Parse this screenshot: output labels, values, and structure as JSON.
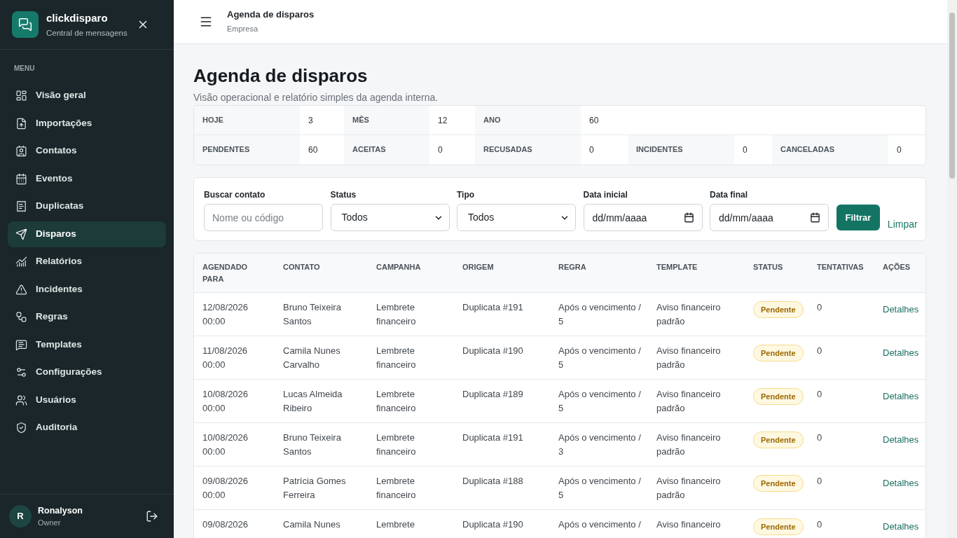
{
  "sidebar": {
    "brand": {
      "name": "clickdisparo",
      "tagline": "Central de mensagens"
    },
    "section_label": "MENU",
    "items": [
      {
        "label": "Visão geral",
        "selected": false
      },
      {
        "label": "Importações",
        "selected": false
      },
      {
        "label": "Contatos",
        "selected": false
      },
      {
        "label": "Eventos",
        "selected": false
      },
      {
        "label": "Duplicatas",
        "selected": false
      },
      {
        "label": "Disparos",
        "selected": true
      },
      {
        "label": "Relatórios",
        "selected": false
      },
      {
        "label": "Incidentes",
        "selected": false
      },
      {
        "label": "Regras",
        "selected": false
      },
      {
        "label": "Templates",
        "selected": false
      },
      {
        "label": "Configurações",
        "selected": false
      },
      {
        "label": "Usuários",
        "selected": false
      },
      {
        "label": "Auditoria",
        "selected": false
      }
    ],
    "user": {
      "initial": "R",
      "name": "Ronalyson",
      "role": "Owner"
    }
  },
  "topbar": {
    "title": "Agenda de disparos",
    "subtitle": "Empresa"
  },
  "page": {
    "title": "Agenda de disparos",
    "description": "Visão operacional e relatório simples da agenda interna."
  },
  "summary": {
    "rows": [
      [
        {
          "label": "HOJE",
          "value": "3"
        },
        {
          "label": "MÊS",
          "value": "12"
        },
        {
          "label": "ANO",
          "value": "60"
        }
      ],
      [
        {
          "label": "PENDENTES",
          "value": "60"
        },
        {
          "label": "ACEITAS",
          "value": "0"
        },
        {
          "label": "RECUSADAS",
          "value": "0"
        },
        {
          "label": "INCIDENTES",
          "value": "0"
        },
        {
          "label": "CANCELADAS",
          "value": "0"
        }
      ]
    ]
  },
  "filters": {
    "fields": [
      {
        "kind": "text",
        "label": "Buscar contato",
        "placeholder": "Nome ou código"
      },
      {
        "kind": "select",
        "label": "Status",
        "value": "Todos"
      },
      {
        "kind": "select",
        "label": "Tipo",
        "value": "Todos"
      },
      {
        "kind": "date",
        "label": "Data inicial",
        "placeholder": "dd/mm/aaaa"
      },
      {
        "kind": "date",
        "label": "Data final",
        "placeholder": "dd/mm/aaaa"
      }
    ],
    "submit": "Filtrar",
    "clear": "Limpar"
  },
  "table": {
    "columns": [
      "AGENDADO PARA",
      "CONTATO",
      "CAMPANHA",
      "ORIGEM",
      "REGRA",
      "TEMPLATE",
      "STATUS",
      "TENTATIVAS",
      "AÇÕES"
    ],
    "rows": [
      {
        "scheduled_for": "12/08/2026 00:00",
        "contact": "Bruno Teixeira Santos",
        "campaign": "Lembrete financeiro",
        "origin": "Duplicata #191",
        "rule": "Após o vencimento / 5",
        "template": "Aviso financeiro padrão",
        "status": {
          "label": "Pendente",
          "kind": "pending"
        },
        "attempts": "0",
        "action": "Detalhes"
      },
      {
        "scheduled_for": "11/08/2026 00:00",
        "contact": "Camila Nunes Carvalho",
        "campaign": "Lembrete financeiro",
        "origin": "Duplicata #190",
        "rule": "Após o vencimento / 5",
        "template": "Aviso financeiro padrão",
        "status": {
          "label": "Pendente",
          "kind": "pending"
        },
        "attempts": "0",
        "action": "Detalhes"
      },
      {
        "scheduled_for": "10/08/2026 00:00",
        "contact": "Lucas Almeida Ribeiro",
        "campaign": "Lembrete financeiro",
        "origin": "Duplicata #189",
        "rule": "Após o vencimento / 5",
        "template": "Aviso financeiro padrão",
        "status": {
          "label": "Pendente",
          "kind": "pending"
        },
        "attempts": "0",
        "action": "Detalhes"
      },
      {
        "scheduled_for": "10/08/2026 00:00",
        "contact": "Bruno Teixeira Santos",
        "campaign": "Lembrete financeiro",
        "origin": "Duplicata #191",
        "rule": "Após o vencimento / 3",
        "template": "Aviso financeiro padrão",
        "status": {
          "label": "Pendente",
          "kind": "pending"
        },
        "attempts": "0",
        "action": "Detalhes"
      },
      {
        "scheduled_for": "09/08/2026 00:00",
        "contact": "Patrícia Gomes Ferreira",
        "campaign": "Lembrete financeiro",
        "origin": "Duplicata #188",
        "rule": "Após o vencimento / 5",
        "template": "Aviso financeiro padrão",
        "status": {
          "label": "Pendente",
          "kind": "pending"
        },
        "attempts": "0",
        "action": "Detalhes"
      },
      {
        "scheduled_for": "09/08/2026",
        "contact": "Camila Nunes",
        "campaign": "Lembrete",
        "origin": "Duplicata #190",
        "rule": "Após o vencimento /",
        "template": "Aviso financeiro",
        "status": {
          "label": "Pendente",
          "kind": "pending"
        },
        "attempts": "0",
        "action": "Detalhes"
      }
    ]
  }
}
